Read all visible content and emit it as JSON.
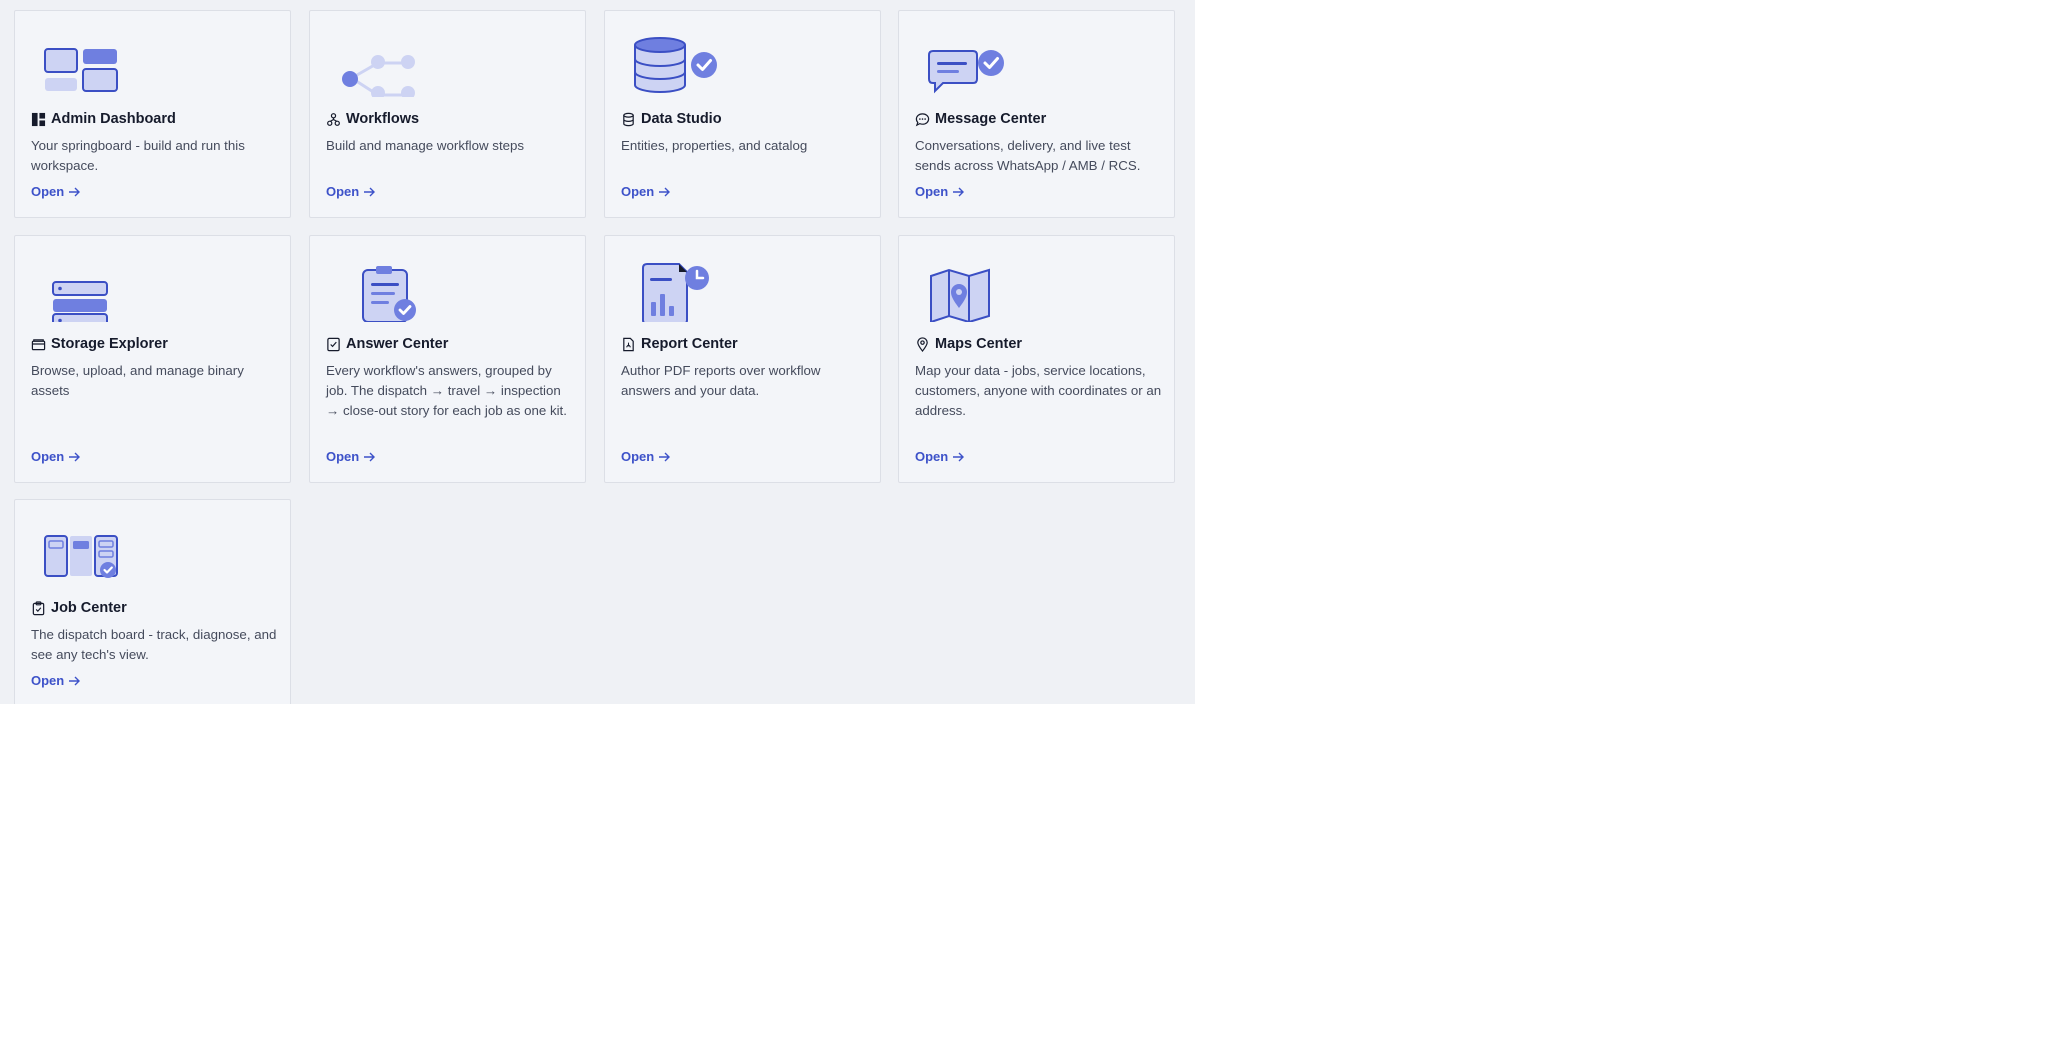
{
  "cards": [
    {
      "title": "Admin Dashboard",
      "title_icon": "dashboard-icon",
      "illustration": "dashboard-illustration",
      "description": "Your springboard - build and run this workspace.",
      "link_label": "Open"
    },
    {
      "title": "Workflows",
      "title_icon": "workflow-icon",
      "illustration": "workflow-illustration",
      "description": "Build and manage workflow steps",
      "link_label": "Open"
    },
    {
      "title": "Data Studio",
      "title_icon": "database-icon",
      "illustration": "database-illustration",
      "description": "Entities, properties, and catalog",
      "link_label": "Open"
    },
    {
      "title": "Message Center",
      "title_icon": "message-icon",
      "illustration": "message-illustration",
      "description": "Conversations, delivery, and live test sends across WhatsApp / AMB / RCS.",
      "link_label": "Open"
    },
    {
      "title": "Storage Explorer",
      "title_icon": "storage-icon",
      "illustration": "storage-illustration",
      "description": "Browse, upload, and manage binary assets",
      "link_label": "Open"
    },
    {
      "title": "Answer Center",
      "title_icon": "checklist-icon",
      "illustration": "clipboard-illustration",
      "description": "Every workflow's answers, grouped by job. The dispatch → travel → inspection → close-out story for each job as one kit.",
      "link_label": "Open"
    },
    {
      "title": "Report Center",
      "title_icon": "pdf-file-icon",
      "illustration": "report-illustration",
      "description": "Author PDF reports over workflow answers and your data.",
      "link_label": "Open"
    },
    {
      "title": "Maps Center",
      "title_icon": "map-pin-icon",
      "illustration": "map-illustration",
      "description": "Map your data - jobs, service locations, customers, anyone with coordinates or an address.",
      "link_label": "Open"
    },
    {
      "title": "Job Center",
      "title_icon": "clipboard-icon",
      "illustration": "job-board-illustration",
      "description": "The dispatch board - track, diagnose, and see any tech's view.",
      "link_label": "Open"
    }
  ],
  "colors": {
    "accent": "#3d52c9",
    "illustration_light": "#cdd3f3",
    "illustration_mid": "#6f7fe0",
    "illustration_stroke": "#3b4fc4",
    "panel_bg": "#eff1f5",
    "card_bg": "#f3f5f9"
  }
}
